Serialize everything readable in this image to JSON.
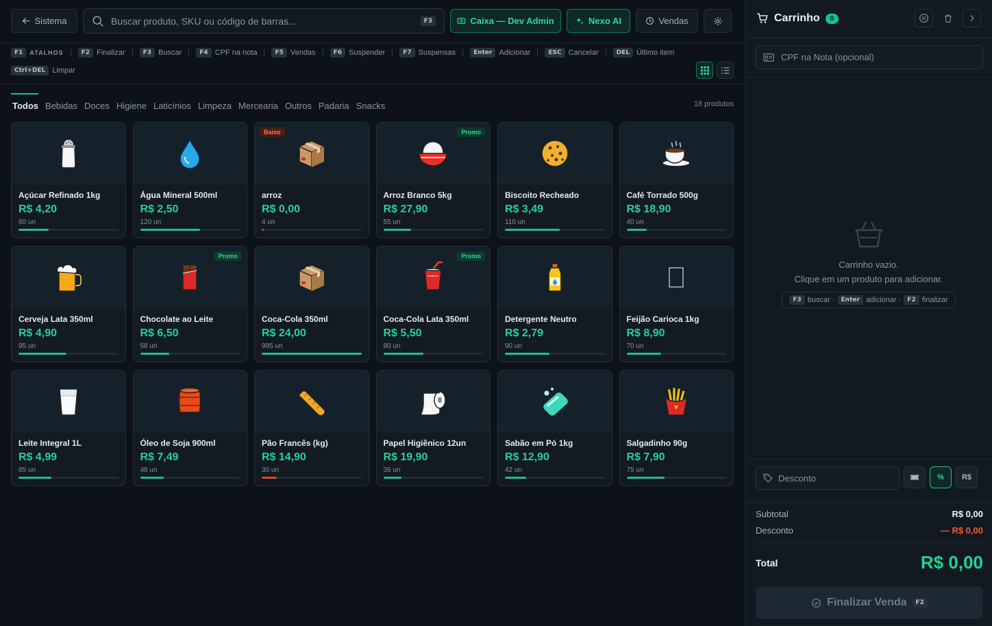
{
  "topbar": {
    "sistema_label": "Sistema",
    "search_placeholder": "Buscar produto, SKU ou código de barras...",
    "search_kbd": "F3",
    "caixa_label": "Caixa — Dev Admin",
    "nexo_label": "Nexo AI",
    "vendas_label": "Vendas"
  },
  "shortcuts": {
    "title_key": "F1",
    "title": "ATALHOS",
    "items": [
      {
        "key": "F2",
        "label": "Finalizar"
      },
      {
        "key": "F3",
        "label": "Buscar"
      },
      {
        "key": "F4",
        "label": "CPF na nota"
      },
      {
        "key": "F5",
        "label": "Vendas"
      },
      {
        "key": "F6",
        "label": "Suspender"
      },
      {
        "key": "F7",
        "label": "Suspensas"
      },
      {
        "key": "Enter",
        "label": "Adicionar"
      },
      {
        "key": "ESC",
        "label": "Cancelar"
      },
      {
        "key": "DEL",
        "label": "Último item"
      },
      {
        "key": "Ctrl+DEL",
        "label": "Limpar"
      }
    ]
  },
  "categories": [
    "Todos",
    "Bebidas",
    "Doces",
    "Higiene",
    "Laticínios",
    "Limpeza",
    "Mercearia",
    "Outros",
    "Padaria",
    "Snacks"
  ],
  "product_count": "18 produtos",
  "products": [
    {
      "name": "Açúcar Refinado 1kg",
      "price": "R$ 4,20",
      "stock": "60 un",
      "level": 30,
      "icon": "salt-shaker-icon",
      "badge": ""
    },
    {
      "name": "Água Mineral 500ml",
      "price": "R$ 2,50",
      "stock": "120 un",
      "level": 60,
      "icon": "water-drop-icon",
      "badge": ""
    },
    {
      "name": "arroz",
      "price": "R$ 0,00",
      "stock": "4 un",
      "level": 2,
      "icon": "package-icon",
      "badge": "Baixo"
    },
    {
      "name": "Arroz Branco 5kg",
      "price": "R$ 27,90",
      "stock": "55 un",
      "level": 28,
      "icon": "rice-bowl-icon",
      "badge": "Promo"
    },
    {
      "name": "Biscoito Recheado",
      "price": "R$ 3,49",
      "stock": "110 un",
      "level": 55,
      "icon": "cookie-icon",
      "badge": ""
    },
    {
      "name": "Café Torrado 500g",
      "price": "R$ 18,90",
      "stock": "40 un",
      "level": 20,
      "icon": "coffee-cup-icon",
      "badge": ""
    },
    {
      "name": "Cerveja Lata 350ml",
      "price": "R$ 4,90",
      "stock": "95 un",
      "level": 48,
      "icon": "beer-mug-icon",
      "badge": ""
    },
    {
      "name": "Chocolate ao Leite",
      "price": "R$ 6,50",
      "stock": "58 un",
      "level": 29,
      "icon": "chocolate-bar-icon",
      "badge": "Promo"
    },
    {
      "name": "Coca-Cola 350ml",
      "price": "R$ 24,00",
      "stock": "995 un",
      "level": 100,
      "icon": "package-icon",
      "badge": ""
    },
    {
      "name": "Coca-Cola Lata 350ml",
      "price": "R$ 5,50",
      "stock": "80 un",
      "level": 40,
      "icon": "soda-cup-icon",
      "badge": "Promo"
    },
    {
      "name": "Detergente Neutro",
      "price": "R$ 2,79",
      "stock": "90 un",
      "level": 45,
      "icon": "detergent-bottle-icon",
      "badge": ""
    },
    {
      "name": "Feijão Carioca 1kg",
      "price": "R$ 8,90",
      "stock": "70 un",
      "level": 35,
      "icon": "placeholder-box-icon",
      "badge": ""
    },
    {
      "name": "Leite Integral 1L",
      "price": "R$ 4,99",
      "stock": "65 un",
      "level": 33,
      "icon": "milk-glass-icon",
      "badge": ""
    },
    {
      "name": "Óleo de Soja 900ml",
      "price": "R$ 7,49",
      "stock": "48 un",
      "level": 24,
      "icon": "oil-barrel-icon",
      "badge": ""
    },
    {
      "name": "Pão Francês (kg)",
      "price": "R$ 14,90",
      "stock": "30 un",
      "level": 15,
      "icon": "bread-icon",
      "badge": "",
      "low": true
    },
    {
      "name": "Papel Higiênico 12un",
      "price": "R$ 19,90",
      "stock": "36 un",
      "level": 18,
      "icon": "toilet-paper-icon",
      "badge": ""
    },
    {
      "name": "Sabão em Pó 1kg",
      "price": "R$ 12,90",
      "stock": "42 un",
      "level": 21,
      "icon": "soap-icon",
      "badge": ""
    },
    {
      "name": "Salgadinho 90g",
      "price": "R$ 7,90",
      "stock": "75 un",
      "level": 38,
      "icon": "fries-icon",
      "badge": ""
    }
  ],
  "cart": {
    "title": "Carrinho",
    "count": "0",
    "cpf_placeholder": "CPF na Nota (opcional)",
    "empty_line1": "Carrinho vazio.",
    "empty_line2": "Clique em um produto para adicionar.",
    "hint_f3_key": "F3",
    "hint_f3": "buscar ·",
    "hint_enter_key": "Enter",
    "hint_enter": "adicionar ·",
    "hint_f2_key": "F2",
    "hint_f2": "finalizar",
    "discount_placeholder": "Desconto",
    "pct_label": "%",
    "rs_label": "R$",
    "subtotal_label": "Subtotal",
    "subtotal_value": "R$ 0,00",
    "desconto_label": "Desconto",
    "desconto_value": "— R$ 0,00",
    "total_label": "Total",
    "total_value": "R$ 0,00",
    "finalizar_label": "Finalizar Venda",
    "finalizar_kbd": "F2"
  },
  "colors": {
    "accent": "#22d394",
    "danger": "#f05a3a",
    "background": "#0d1218"
  }
}
